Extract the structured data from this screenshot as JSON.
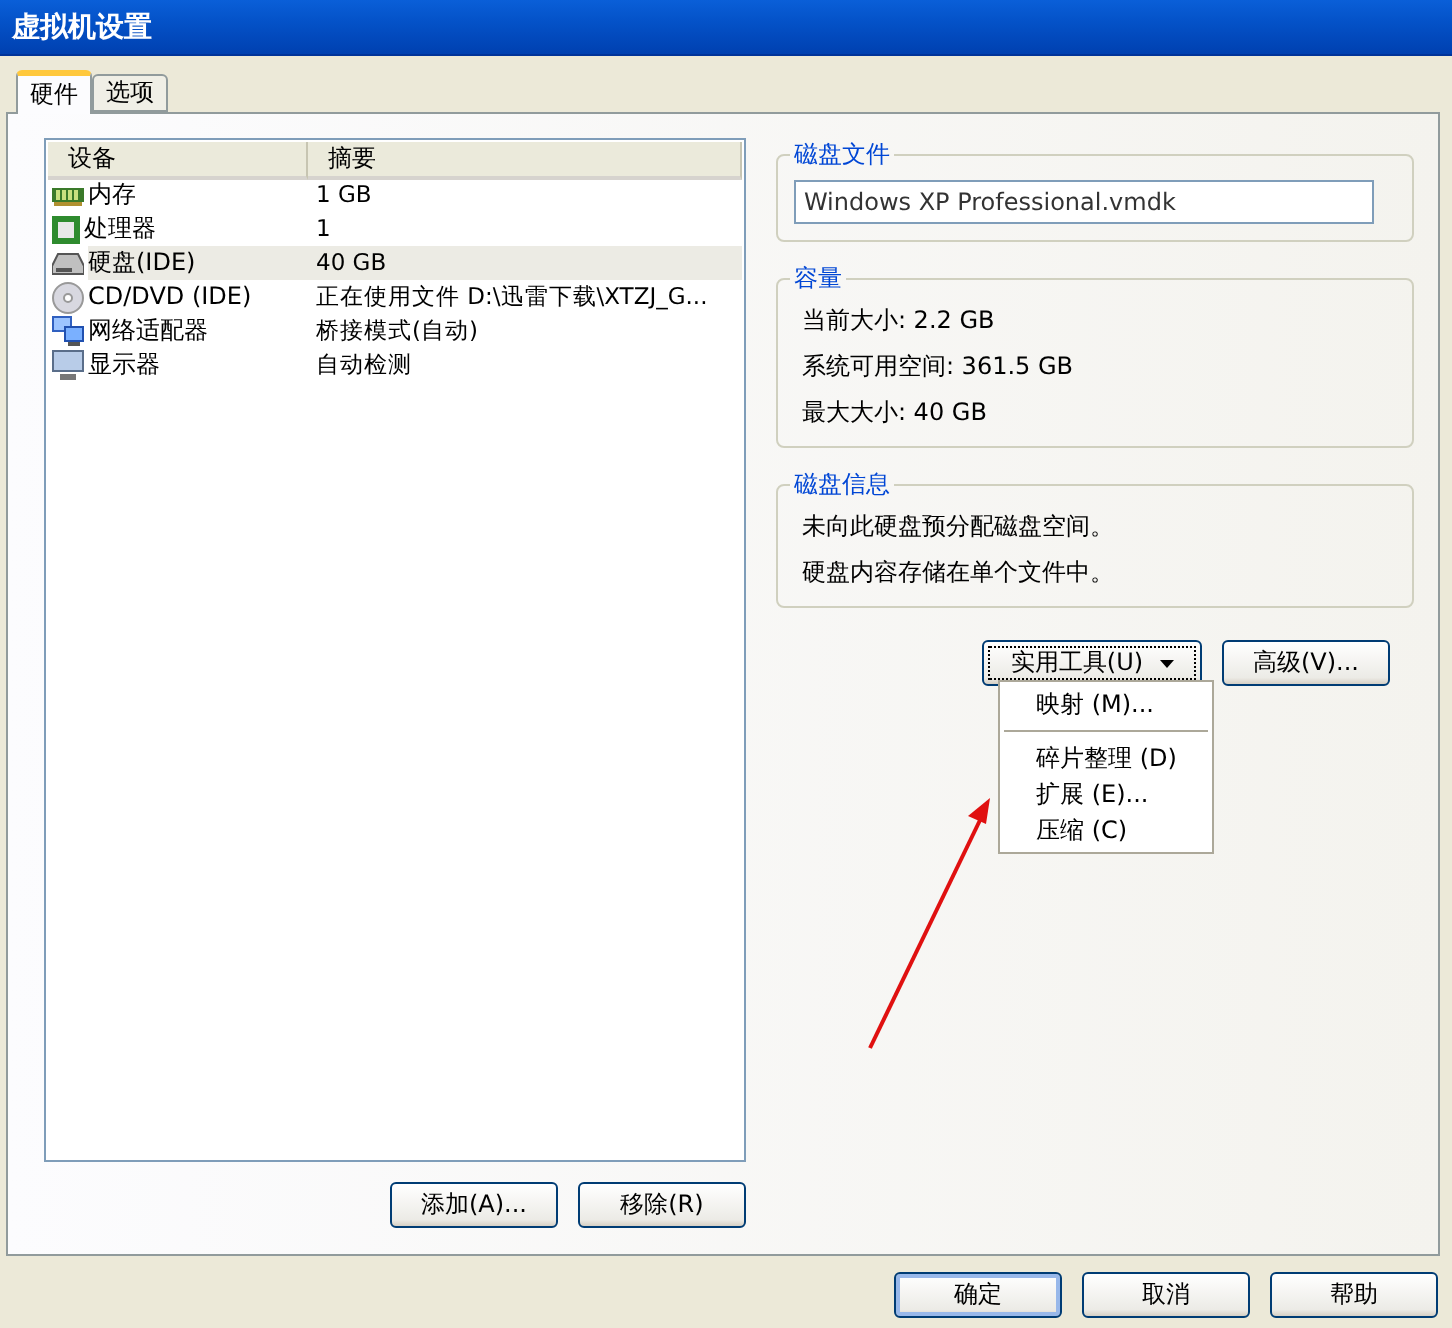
{
  "window": {
    "title": "虚拟机设置"
  },
  "tabs": [
    {
      "label": "硬件",
      "selected": true
    },
    {
      "label": "选项",
      "selected": false
    }
  ],
  "device_table": {
    "columns": [
      "设备",
      "摘要"
    ],
    "rows": [
      {
        "device": "内存",
        "summary": "1 GB",
        "kind": "memory",
        "selected": false
      },
      {
        "device": "处理器",
        "summary": "1",
        "kind": "cpu",
        "selected": false
      },
      {
        "device": "硬盘(IDE)",
        "summary": "40 GB",
        "kind": "disk",
        "selected": true
      },
      {
        "device": "CD/DVD (IDE)",
        "summary": "正在使用文件 D:\\迅雷下载\\XTZJ_G...",
        "kind": "cdrom",
        "selected": false
      },
      {
        "device": "网络适配器",
        "summary": "桥接模式(自动)",
        "kind": "network",
        "selected": false
      },
      {
        "device": "显示器",
        "summary": "自动检测",
        "kind": "display",
        "selected": false
      }
    ]
  },
  "device_buttons": [
    "添加(A)...",
    "移除(R)"
  ],
  "disk_file": {
    "title": "磁盘文件",
    "value": "Windows XP Professional.vmdk"
  },
  "capacity": {
    "title": "容量",
    "lines": [
      "当前大小: 2.2 GB",
      "系统可用空间: 361.5 GB",
      "最大大小: 40 GB"
    ]
  },
  "disk_info": {
    "title": "磁盘信息",
    "lines": [
      "未向此硬盘预分配磁盘空间。",
      "硬盘内容存储在单个文件中。"
    ]
  },
  "utility_button": "实用工具(U)",
  "advanced_button": "高级(V)...",
  "utility_menu": [
    {
      "kind": "item",
      "label": "映射 (M)..."
    },
    {
      "kind": "separator"
    },
    {
      "kind": "item",
      "label": "碎片整理 (D)"
    },
    {
      "kind": "item",
      "label": "扩展 (E)..."
    },
    {
      "kind": "item",
      "label": "压缩 (C)"
    }
  ],
  "dialog_buttons": [
    {
      "label": "确定",
      "default": true
    },
    {
      "label": "取消",
      "default": false
    },
    {
      "label": "帮助",
      "default": false
    }
  ]
}
